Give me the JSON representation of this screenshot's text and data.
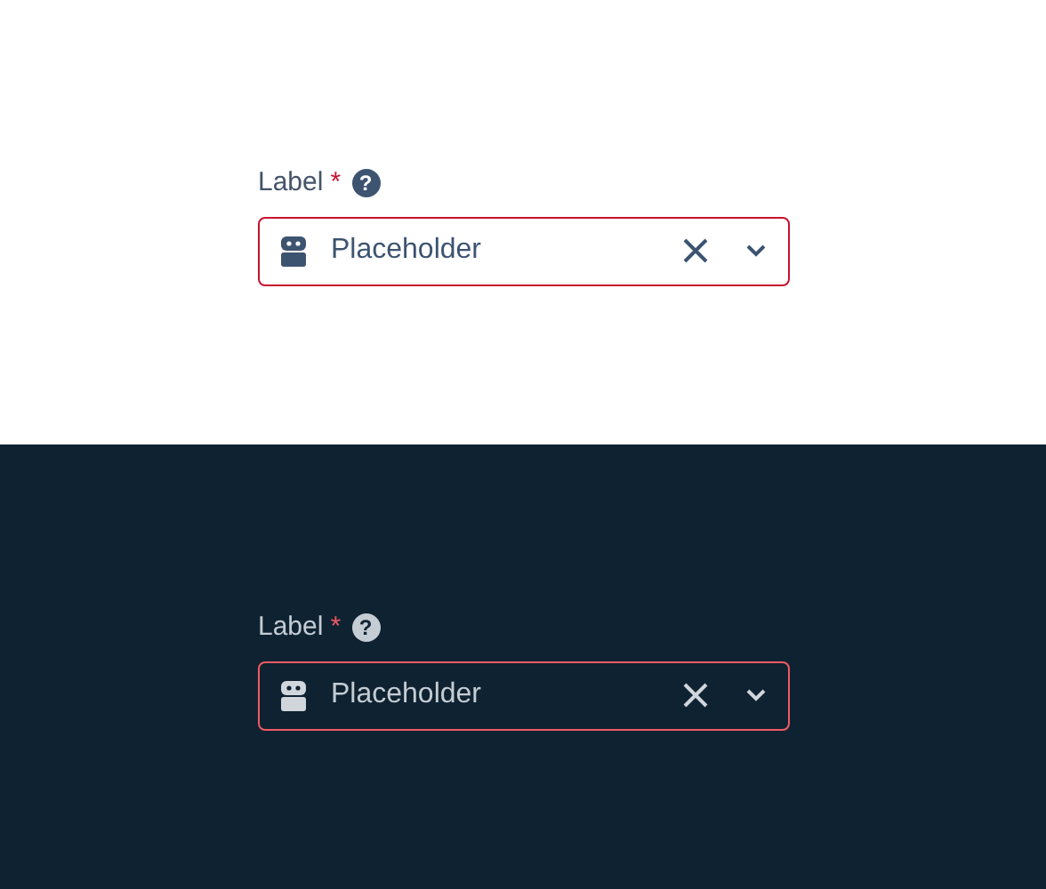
{
  "panels": [
    {
      "kind": "light",
      "label": "Label",
      "required_mark": "*",
      "help": "?",
      "placeholder": "Placeholder",
      "invalid": true
    },
    {
      "kind": "dark",
      "label": "Label",
      "required_mark": "*",
      "help": "?",
      "placeholder": "Placeholder",
      "invalid": true
    }
  ]
}
